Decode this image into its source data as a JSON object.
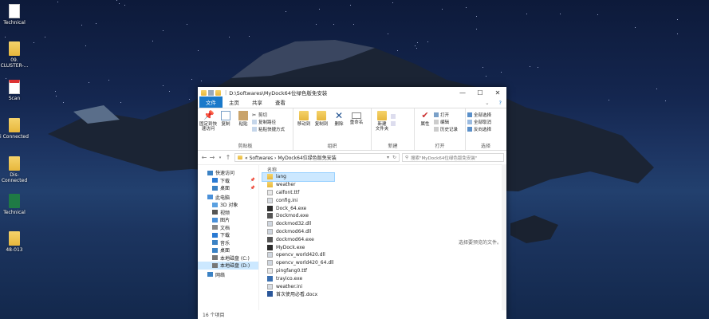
{
  "desktop": {
    "icons": [
      {
        "label": "Technical",
        "type": "doc"
      },
      {
        "label": "09.\nCLUSTER-...",
        "type": "folder"
      },
      {
        "label": "Scan",
        "type": "pdf"
      },
      {
        "label": "i Connected",
        "type": "folder"
      },
      {
        "label": "Dis-\nConnected",
        "type": "folder"
      },
      {
        "label": "Technical",
        "type": "xls"
      },
      {
        "label": "48-013",
        "type": "folder"
      }
    ]
  },
  "window": {
    "title": "D:\\Softwares\\MyDock64位绿色版免安装",
    "controls": {
      "minimize": "—",
      "maximize": "☐",
      "close": "✕"
    },
    "tabs": [
      "文件",
      "主页",
      "共享",
      "查看"
    ],
    "ribbon": {
      "clipboard": {
        "pin": "固定到快\n速访问",
        "copy": "复制",
        "paste": "粘贴",
        "cut": "剪切",
        "copy_path": "复制路径",
        "paste_shortcut": "粘贴快捷方式",
        "group": "剪贴板"
      },
      "organize": {
        "move_to": "移动到",
        "copy_to": "复制到",
        "delete": "删除",
        "rename": "重命名",
        "group": "组织"
      },
      "new": {
        "new_folder": "新建\n文件夹",
        "group": "新建"
      },
      "open": {
        "properties": "属性",
        "open": "打开",
        "edit": "编辑",
        "history": "历史记录",
        "group": "打开"
      },
      "select": {
        "select_all": "全部选择",
        "select_none": "全部取消",
        "invert": "反向选择",
        "group": "选择"
      }
    },
    "address": {
      "back": "←",
      "forward": "→",
      "up": "↑",
      "path": "«  Softwares  ›  MyDock64位绿色版免安装",
      "search_placeholder": "搜索\"MyDock64位绿色版免安装\""
    },
    "nav": [
      {
        "label": "快速访问",
        "icon": "star-icon",
        "level": 0
      },
      {
        "label": "下载",
        "icon": "download-icon",
        "level": 1,
        "pin": "📌"
      },
      {
        "label": "桌面",
        "icon": "desktop-icon",
        "level": 1,
        "pin": "📌"
      },
      {
        "label": "此电脑",
        "icon": "pc-icon",
        "level": 0
      },
      {
        "label": "3D 对象",
        "icon": "3d-icon",
        "level": 1
      },
      {
        "label": "视频",
        "icon": "video-icon",
        "level": 1
      },
      {
        "label": "图片",
        "icon": "picture-icon",
        "level": 1
      },
      {
        "label": "文档",
        "icon": "document-icon",
        "level": 1
      },
      {
        "label": "下载",
        "icon": "download-icon",
        "level": 1
      },
      {
        "label": "音乐",
        "icon": "music-icon",
        "level": 1
      },
      {
        "label": "桌面",
        "icon": "desktop-icon",
        "level": 1
      },
      {
        "label": "本地磁盘 (C:)",
        "icon": "drive-icon",
        "level": 1
      },
      {
        "label": "本地磁盘 (D:)",
        "icon": "drive-icon",
        "level": 1,
        "selected": true
      },
      {
        "label": "网络",
        "icon": "network-icon",
        "level": 0
      }
    ],
    "column_header": "名称",
    "files": [
      {
        "name": "lang",
        "type": "folder",
        "selected": true
      },
      {
        "name": "weather",
        "type": "folder"
      },
      {
        "name": "calfont.ttf",
        "type": "font"
      },
      {
        "name": "config.ini",
        "type": "ini"
      },
      {
        "name": "Dock_64.exe",
        "type": "exe"
      },
      {
        "name": "Dockmod.exe",
        "type": "exe2"
      },
      {
        "name": "dockmod32.dll",
        "type": "dll"
      },
      {
        "name": "dockmod64.dll",
        "type": "dll"
      },
      {
        "name": "dockmod64.exe",
        "type": "exe2"
      },
      {
        "name": "MyDock.exe",
        "type": "exe"
      },
      {
        "name": "opencv_world420.dll",
        "type": "dll"
      },
      {
        "name": "opencv_world420_64.dll",
        "type": "dll"
      },
      {
        "name": "pingfang0.ttf",
        "type": "font"
      },
      {
        "name": "trayico.exe",
        "type": "exe3"
      },
      {
        "name": "weather.ini",
        "type": "ini"
      },
      {
        "name": "首次使用必看.docx",
        "type": "docx"
      }
    ],
    "empty_preview": "选择要预览的文件。",
    "status": "16 个项目"
  },
  "colors": {
    "accent": "#1979ca",
    "selection": "#cce8ff",
    "folder": "#f2c94c"
  }
}
